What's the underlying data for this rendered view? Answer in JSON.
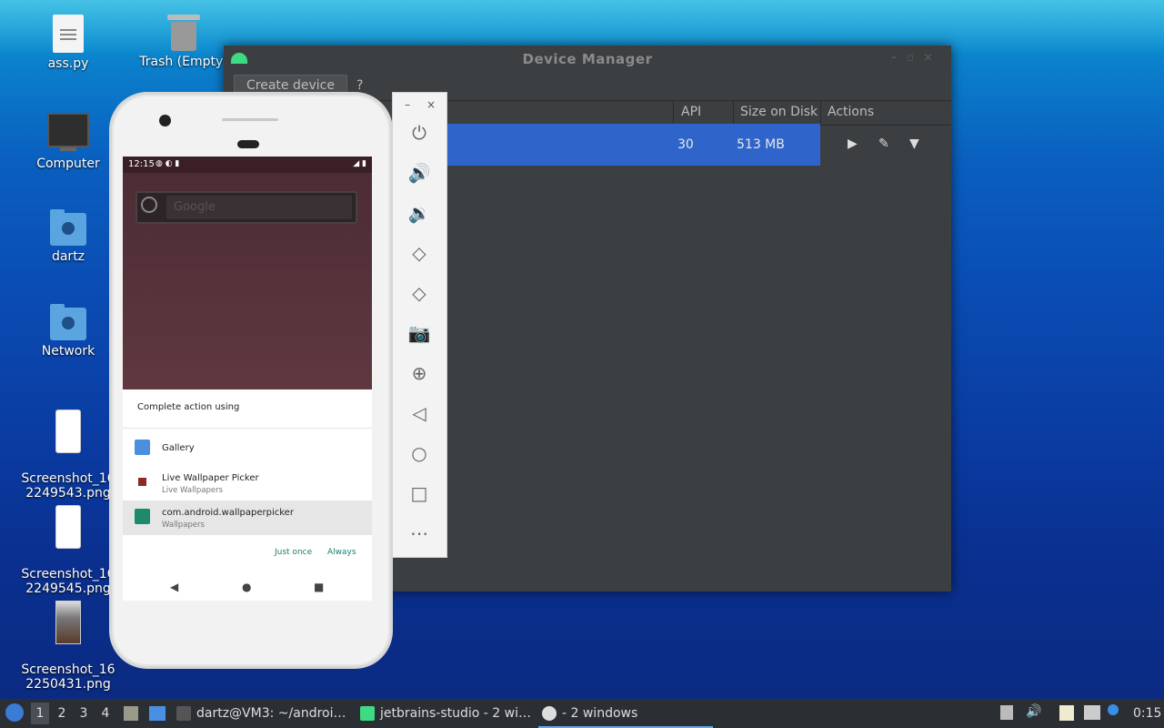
{
  "desktop": {
    "icons": [
      {
        "label": "ass.py",
        "icon": "python-file-icon"
      },
      {
        "label": "Trash (Empty)",
        "icon": "trash-icon"
      },
      {
        "label": "Computer",
        "icon": "computer-icon"
      },
      {
        "label": "dartz",
        "icon": "home-folder-icon"
      },
      {
        "label": "Network",
        "icon": "network-folder-icon"
      },
      {
        "label": "Screenshot_16\n2249543.png",
        "icon": "image-file-icon"
      },
      {
        "label": "Screenshot_16\n2249545.png",
        "icon": "image-file-icon"
      },
      {
        "label": "Screenshot_16\n2250431.png",
        "icon": "image-file-icon"
      }
    ]
  },
  "device_manager": {
    "title": "Device Manager",
    "create_label": "Create device",
    "help_label": "?",
    "columns": {
      "api": "API",
      "size": "Size on Disk",
      "actions": "Actions"
    },
    "row": {
      "api": "30",
      "size": "513 MB"
    },
    "accent": "#2f65ca"
  },
  "emulator_toolbar": {
    "minimize": "–",
    "close": "×",
    "buttons": [
      "power-icon",
      "volume-up-icon",
      "volume-down-icon",
      "rotate-left-icon",
      "rotate-right-icon",
      "camera-icon",
      "zoom-icon",
      "back-icon",
      "home-icon",
      "overview-icon",
      "more-icon"
    ]
  },
  "phone": {
    "status_time": "12:15",
    "search_placeholder": "Google",
    "sheet_title": "Complete action using",
    "apps": [
      {
        "name": "Gallery",
        "sub": "",
        "color": "#4a8fe0"
      },
      {
        "name": "Live Wallpaper Picker",
        "sub": "Live Wallpapers",
        "color": "#8a2a2a"
      },
      {
        "name": "com.android.wallpaperpicker",
        "sub": "Wallpapers",
        "color": "#1d8a6d"
      }
    ],
    "just_once": "Just once",
    "always": "Always"
  },
  "taskbar": {
    "workspaces": [
      "1",
      "2",
      "3",
      "4"
    ],
    "tasks": [
      {
        "label": "dartz@VM3: ~/androi…",
        "color": "#555"
      },
      {
        "label": "jetbrains-studio - 2 wi…",
        "color": "#3ddc84"
      },
      {
        "label": "- 2 windows",
        "color": "#ddd"
      }
    ],
    "clock": "0:15"
  }
}
